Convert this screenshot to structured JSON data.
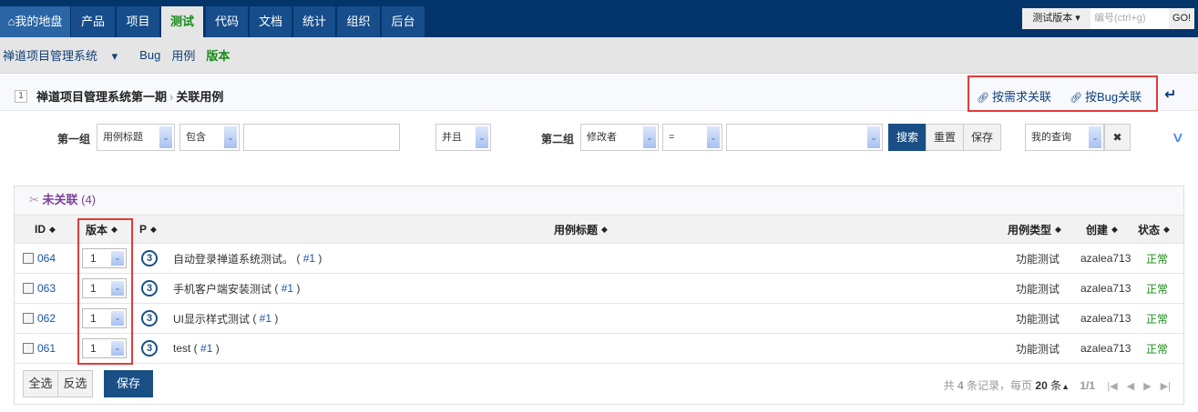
{
  "topnav": {
    "tabs": [
      {
        "label": "我的地盘",
        "icon": "home-icon"
      },
      {
        "label": "产品"
      },
      {
        "label": "项目"
      },
      {
        "label": "测试",
        "active": true
      },
      {
        "label": "代码"
      },
      {
        "label": "文档"
      },
      {
        "label": "统计"
      },
      {
        "label": "组织"
      },
      {
        "label": "后台"
      }
    ],
    "quick": {
      "dropdown": "测试版本",
      "placeholder": "编号(ctrl+g)",
      "go": "GO!"
    }
  },
  "subnav": {
    "product": "禅道项目管理系统",
    "items": [
      "Bug",
      "用例",
      "版本"
    ],
    "active": "版本"
  },
  "header": {
    "id": "1",
    "title": "禅道项目管理系统第一期",
    "separator": "›",
    "subtitle": "关联用例",
    "links": [
      "按需求关联",
      "按Bug关联"
    ]
  },
  "search": {
    "group1": "第一组",
    "field1": "用例标题",
    "op1": "包含",
    "value1": "",
    "andor": "并且",
    "group2": "第二组",
    "field2": "修改者",
    "op2": "=",
    "value2": "",
    "search": "搜索",
    "reset": "重置",
    "save": "保存",
    "query": "我的查询"
  },
  "panel": {
    "title": "未关联",
    "count": "(4)"
  },
  "table": {
    "columns": [
      "ID",
      "版本",
      "P",
      "用例标题",
      "用例类型",
      "创建",
      "状态"
    ],
    "rows": [
      {
        "id": "064",
        "version": "1",
        "pri": "3",
        "title": "自动登录禅道系统测试。",
        "story": "#1",
        "type": "功能测试",
        "creator": "azalea713",
        "status": "正常"
      },
      {
        "id": "063",
        "version": "1",
        "pri": "3",
        "title": "手机客户端安装测试",
        "story": "#1",
        "type": "功能测试",
        "creator": "azalea713",
        "status": "正常"
      },
      {
        "id": "062",
        "version": "1",
        "pri": "3",
        "title": "UI显示样式测试",
        "story": "#1",
        "type": "功能测试",
        "creator": "azalea713",
        "status": "正常"
      },
      {
        "id": "061",
        "version": "1",
        "pri": "3",
        "title": "test",
        "story": "#1",
        "type": "功能测试",
        "creator": "azalea713",
        "status": "正常"
      }
    ]
  },
  "footer": {
    "select_all": "全选",
    "invert": "反选",
    "save": "保存",
    "pager": {
      "prefix": "共",
      "total": "4",
      "mid": "条记录，每页",
      "per_page": "20",
      "unit": "条",
      "page": "1/1"
    }
  }
}
